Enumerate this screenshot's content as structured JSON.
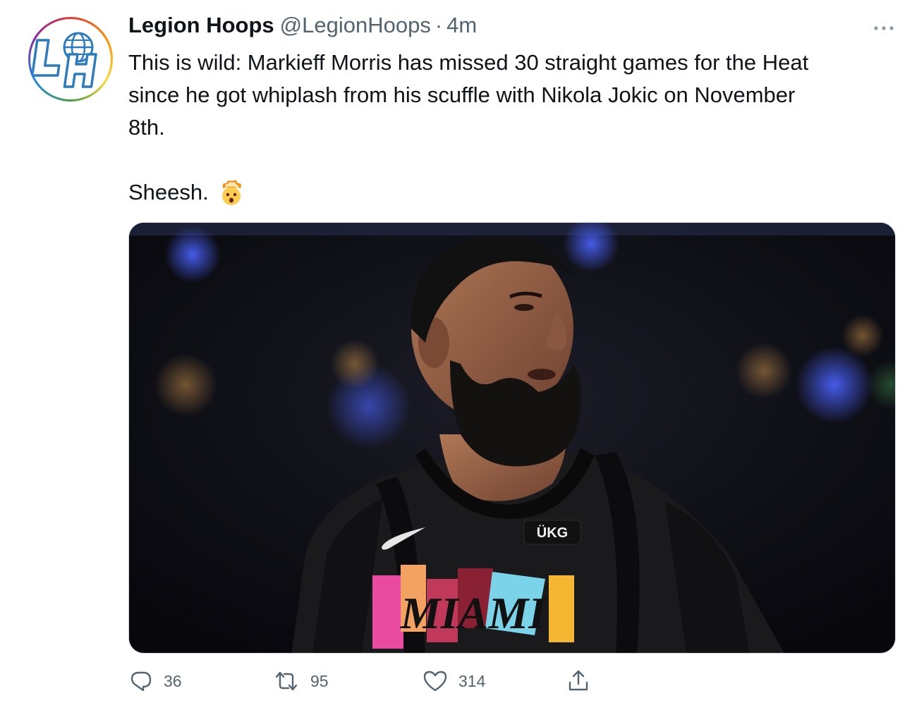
{
  "tweet": {
    "display_name": "Legion Hoops",
    "handle": "@LegionHoops",
    "separator": "·",
    "time": "4m",
    "text_lines": [
      "This is wild: Markieff Morris has missed 30 straight games for the Heat",
      "since he got whiplash from his scuffle with Nikola Jokic on November",
      "8th."
    ],
    "closing_text": "Sheesh.",
    "closing_emoji": "exploding-head-icon",
    "avatar_letters": "LH",
    "media": {
      "jersey_brand": "ÜKG",
      "jersey_wordmark": "MIAMI"
    },
    "actions": {
      "replies": "36",
      "retweets": "95",
      "likes": "314"
    }
  },
  "colors": {
    "text": "#0f1419",
    "secondary": "#536471",
    "media_border": "#cfd9de",
    "avatar_brand": "#2b7bc0"
  }
}
